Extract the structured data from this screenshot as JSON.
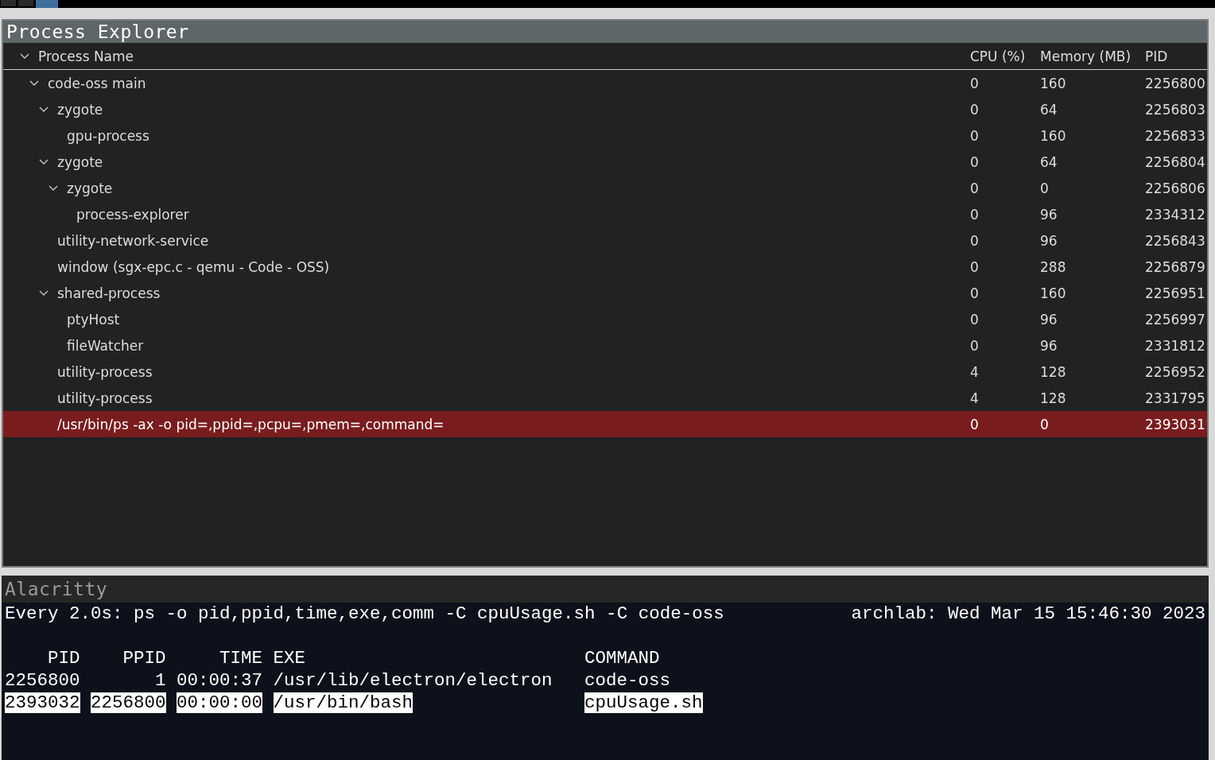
{
  "workspaces": [
    {
      "selected": false
    },
    {
      "selected": false
    },
    {
      "selected": true
    }
  ],
  "process_explorer": {
    "title": "Process Explorer",
    "columns": [
      {
        "label": "Process Name",
        "expanded": true
      },
      {
        "label": "CPU (%)"
      },
      {
        "label": "Memory (MB)"
      },
      {
        "label": "PID"
      }
    ],
    "rows": [
      {
        "name": "code-oss main",
        "cpu": "0",
        "memory": "160",
        "pid": "2256800",
        "selected": false,
        "expanded": true,
        "children": [
          {
            "name": "zygote",
            "cpu": "0",
            "memory": "64",
            "pid": "2256803",
            "selected": false,
            "expanded": true,
            "children": [
              {
                "name": "gpu-process",
                "cpu": "0",
                "memory": "160",
                "pid": "2256833",
                "selected": false
              }
            ]
          },
          {
            "name": "zygote",
            "cpu": "0",
            "memory": "64",
            "pid": "2256804",
            "selected": false,
            "expanded": true,
            "children": [
              {
                "name": "zygote",
                "cpu": "0",
                "memory": "0",
                "pid": "2256806",
                "selected": false,
                "expanded": true,
                "children": [
                  {
                    "name": "process-explorer",
                    "cpu": "0",
                    "memory": "96",
                    "pid": "2334312",
                    "selected": false
                  }
                ]
              }
            ]
          },
          {
            "name": "utility-network-service",
            "cpu": "0",
            "memory": "96",
            "pid": "2256843",
            "selected": false
          },
          {
            "name": "window (sgx-epc.c - qemu - Code - OSS)",
            "cpu": "0",
            "memory": "288",
            "pid": "2256879",
            "selected": false
          },
          {
            "name": "shared-process",
            "cpu": "0",
            "memory": "160",
            "pid": "2256951",
            "selected": false,
            "expanded": true,
            "children": [
              {
                "name": "ptyHost",
                "cpu": "0",
                "memory": "96",
                "pid": "2256997",
                "selected": false
              },
              {
                "name": "fileWatcher",
                "cpu": "0",
                "memory": "96",
                "pid": "2331812",
                "selected": false
              }
            ]
          },
          {
            "name": "utility-process",
            "cpu": "4",
            "memory": "128",
            "pid": "2256952",
            "selected": false
          },
          {
            "name": "utility-process",
            "cpu": "4",
            "memory": "128",
            "pid": "2331795",
            "selected": false
          },
          {
            "name": "/usr/bin/ps -ax -o pid=,ppid=,pcpu=,pmem=,command=",
            "cpu": "0",
            "memory": "0",
            "pid": "2393031",
            "selected": true
          }
        ]
      }
    ]
  },
  "terminal": {
    "title": "Alacritty",
    "command": "Every 2.0s: ps -o pid,ppid,time,exe,comm -C cpuUsage.sh -C code-oss",
    "status": "archlab: Wed Mar 15 15:46:30 2023",
    "columns": [
      "PID",
      "PPID",
      "TIME",
      "EXE",
      "COMMAND"
    ],
    "rows": [
      {
        "cells": [
          {
            "text": "2256800",
            "highlighted": false
          },
          {
            "text": "1",
            "highlighted": false
          },
          {
            "text": "00:00:37",
            "highlighted": false
          },
          {
            "text": "/usr/lib/electron/electron",
            "highlighted": false
          },
          {
            "text": "code-oss",
            "highlighted": false
          }
        ]
      },
      {
        "cells": [
          {
            "text": "2393032",
            "highlighted": true
          },
          {
            "text": "2256800",
            "highlighted": true
          },
          {
            "text": "00:00:00",
            "highlighted": true
          },
          {
            "text": "/usr/bin/bash",
            "highlighted": true
          },
          {
            "text": "cpuUsage.sh",
            "highlighted": true
          }
        ]
      }
    ]
  }
}
